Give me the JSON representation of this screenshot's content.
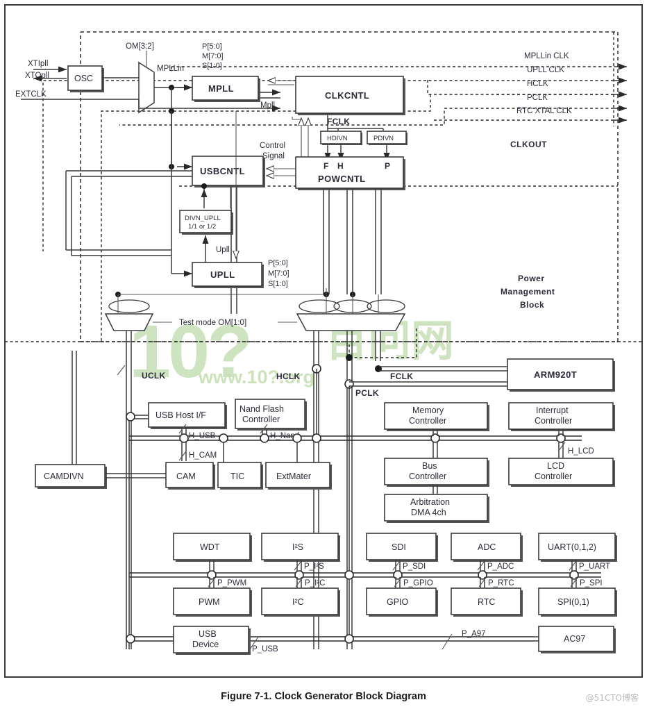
{
  "figure": {
    "caption": "Figure 7-1. Clock Generator Block Diagram"
  },
  "watermark": {
    "big": "10?",
    "cjk": "百问网",
    "url": "www.10?.org",
    "corner": "@51CTO博客"
  },
  "inputs": [
    {
      "name": "XTIpll",
      "label": "XTIpll"
    },
    {
      "name": "XTOpll",
      "label": "XTOpll"
    },
    {
      "name": "EXTCLK",
      "label": "EXTCLK"
    }
  ],
  "clock_outputs": [
    {
      "label": "MPLLin CLK"
    },
    {
      "label": "UPLL CLK"
    },
    {
      "label": "HCLK"
    },
    {
      "label": "PCLK"
    },
    {
      "label": "RTC XTAL CLK"
    }
  ],
  "power_block": {
    "clkout_label": "CLKOUT",
    "title_line1": "Power",
    "title_line2": "Management",
    "title_line3": "Block"
  },
  "pll_params": {
    "p": "P[5:0]",
    "m": "M[7:0]",
    "s": "S[1:0]"
  },
  "mode_selects": {
    "om32": "OM[3:2]",
    "test_mode": "Test mode OM[1:0]"
  },
  "signals": {
    "mpllin": "MPLLin",
    "mpll_out": "Mpll",
    "upll_out": "Upll",
    "fclk": "FCLK",
    "control_signal_1": "Control",
    "control_signal_2": "Signal",
    "f": "F",
    "h": "H",
    "p": "P"
  },
  "clock_domains": {
    "uclk": "UCLK",
    "hclk": "HCLK",
    "pclk": "PCLK",
    "fclk": "FCLK"
  },
  "core_blocks": {
    "osc": "OSC",
    "mpll": "MPLL",
    "upll": "UPLL",
    "clkcntl": "CLKCNTL",
    "usbcntl": "USBCNTL",
    "powcntl": "POWCNTL",
    "hdivn": "HDIVN",
    "pdivn": "PDIVN",
    "divn_upll_line1": "DIVN_UPLL",
    "divn_upll_line2": "1/1 or 1/2",
    "camdivn": "CAMDIVN",
    "arm": "ARM920T"
  },
  "ahb_blocks": [
    {
      "name": "usb-host-if",
      "line1": "USB Host I/F",
      "line2": ""
    },
    {
      "name": "nand-flash-controller",
      "line1": "Nand Flash",
      "line2": "Controller"
    },
    {
      "name": "memory-controller",
      "line1": "Memory",
      "line2": "Controller"
    },
    {
      "name": "interrupt-controller",
      "line1": "Interrupt",
      "line2": "Controller"
    },
    {
      "name": "cam",
      "line1": "CAM",
      "line2": ""
    },
    {
      "name": "tic",
      "line1": "TIC",
      "line2": ""
    },
    {
      "name": "extmater",
      "line1": "ExtMater",
      "line2": ""
    },
    {
      "name": "bus-controller",
      "line1": "Bus",
      "line2": "Controller"
    },
    {
      "name": "lcd-controller",
      "line1": "LCD",
      "line2": "Controller"
    },
    {
      "name": "arbitration-dma",
      "line1": "Arbitration",
      "line2": "DMA 4ch"
    }
  ],
  "ahb_bus_labels": [
    {
      "label": "H_USB"
    },
    {
      "label": "H_Nand"
    },
    {
      "label": "H_CAM"
    },
    {
      "label": "H_LCD"
    }
  ],
  "apb_blocks_top": [
    {
      "label": "WDT"
    },
    {
      "label": "I²S"
    },
    {
      "label": "SDI"
    },
    {
      "label": "ADC"
    },
    {
      "label": "UART(0,1,2)"
    }
  ],
  "apb_blocks_bottom": [
    {
      "label": "PWM"
    },
    {
      "label": "I²C"
    },
    {
      "label": "GPIO"
    },
    {
      "label": "RTC"
    },
    {
      "label": "SPI(0,1)"
    }
  ],
  "apb_bus_labels_top": [
    {
      "label": "P_I²S"
    },
    {
      "label": "P_SDI"
    },
    {
      "label": "P_ADC"
    },
    {
      "label": "P_UART"
    }
  ],
  "apb_bus_labels_bottom": [
    {
      "label": "P_PWM"
    },
    {
      "label": "P_I²C"
    },
    {
      "label": "P_GPIO"
    },
    {
      "label": "P_RTC"
    },
    {
      "label": "P_SPI"
    }
  ],
  "bottom_row": {
    "usb_device_line1": "USB",
    "usb_device_line2": "Device",
    "p_usb": "P_USB",
    "p_a97": "P_A97",
    "ac97": "AC97"
  },
  "colors": {
    "ink": "#2b2b3a",
    "line": "#3a3a3a",
    "watermark": "#c6dfb4",
    "background": "#ffffff"
  }
}
